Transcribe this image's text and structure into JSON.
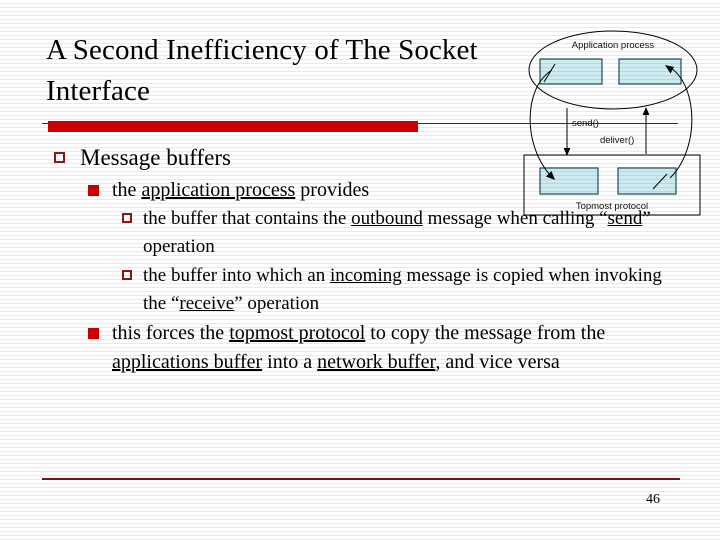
{
  "slide": {
    "title": "A Second Inefficiency of The Socket Interface",
    "page_number": "46",
    "accent_color": "#cc0000",
    "rule_color": "#8a1111",
    "bullet_outline_color": "#8f1616",
    "background_color": "#ffffff"
  },
  "content": {
    "level1": {
      "bullet_glyph": "hollow-square",
      "text": "Message buffers"
    },
    "level2_first": {
      "bullet_glyph": "filled-square",
      "text_before": "the ",
      "underlined": "application process",
      "text_after": " provides"
    },
    "sub_items": [
      {
        "bullet_glyph": "hollow-square",
        "part1": "the buffer that contains the ",
        "underline1": "outbound",
        "part2": " message when calling “",
        "underline2": "send",
        "part3": "” operation"
      },
      {
        "bullet_glyph": "hollow-square",
        "part1": "the buffer into which an ",
        "underline1": "incoming",
        "part2": " message is copied when invoking the “",
        "underline2": "receive",
        "part3": "” operation"
      }
    ],
    "level2_second": {
      "bullet_glyph": "filled-square",
      "part1": "this forces the ",
      "underline1": "topmost protocol",
      "part2": " to copy the message from the ",
      "underline2": "applications buffer",
      "part3": " into a ",
      "underline3": "network buffer",
      "part4": ", and vice versa"
    }
  },
  "diagram": {
    "ellipse_label": "Application process",
    "box_label": "Topmost protocol",
    "arrow_label_left": "send()",
    "arrow_label_right": "deliver()",
    "buffer_fill_color": "#cdeaf0",
    "buffer_border_color": "#1b4f5c",
    "line_color": "#000000"
  }
}
